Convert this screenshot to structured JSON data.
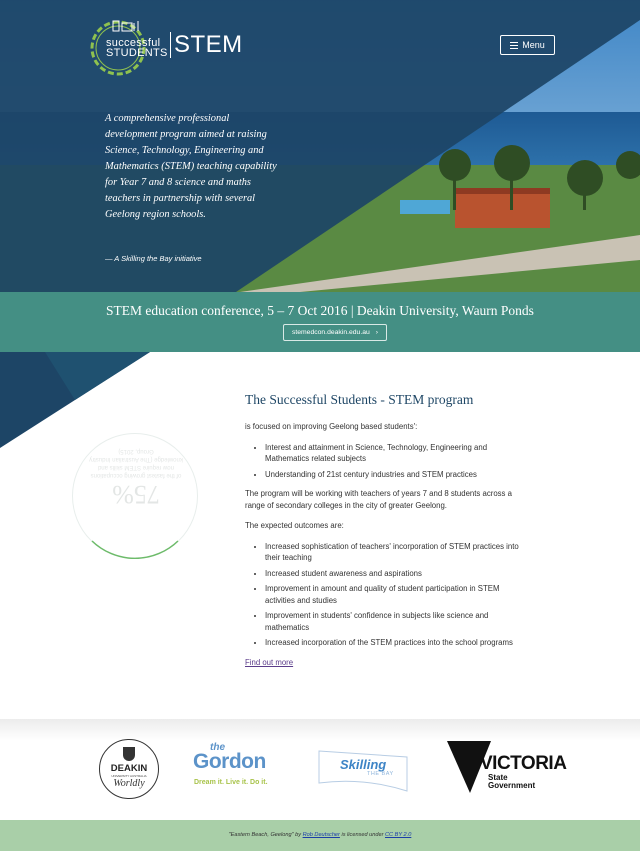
{
  "header": {
    "logo_small_line1": "successful",
    "logo_small_line2": "STUDENTS",
    "logo_stem": "STEM",
    "menu_label": "Menu"
  },
  "hero": {
    "intro": "A comprehensive professional development program aimed at raising Science, Technology, Engineering and Mathematics (STEM) teaching capability for Year 7 and 8 science and maths teachers in partnership with several Geelong region schools.",
    "credit": "— A Skilling the Bay initiative"
  },
  "conference": {
    "title": "STEM education conference, 5 – 7 Oct 2016 | Deakin University, Waurn Ponds",
    "link_label": "stemedcon.deakin.edu.au"
  },
  "stat": {
    "percent": "75%",
    "description": "of the fastest growing occupations now require STEM skills and knowledge (The Australian Industry Group, 2015)"
  },
  "program": {
    "heading": "The Successful Students - STEM program",
    "intro": "is focused on improving Geelong based students':",
    "focus_items": [
      "Interest and attainment in Science, Technology, Engineering and Mathematics related subjects",
      "Understanding of 21st century industries and STEM practices"
    ],
    "paragraph": "The program will be working with teachers of years 7 and 8 students across a range of secondary colleges in the city of greater Geelong.",
    "outcomes_label": "The expected outcomes are:",
    "outcomes": [
      "Increased sophistication of teachers' incorporation of STEM practices into their teaching",
      "Increased student awareness and aspirations",
      "Improvement in amount and quality of student participation in STEM activities and studies",
      "Improvement in students' confidence in subjects like science and mathematics",
      "Increased incorporation of the STEM practices into the school programs"
    ],
    "link_label": "Find out more"
  },
  "partners": {
    "deakin_name": "DEAKIN",
    "deakin_sub": "UNIVERSITY AUSTRALIA",
    "deakin_tag": "Worldly",
    "gordon_the": "the",
    "gordon_name": "Gordon",
    "gordon_tag": "Dream it. Live it. Do it.",
    "skilling_name": "Skilling",
    "skilling_sub": "THE BAY",
    "vic_name": "VICTORIA",
    "vic_sub1": "State",
    "vic_sub2": "Government"
  },
  "footer": {
    "photo_title": "\"Eastern Beach, Geelong\" by ",
    "author": "Rob Deutscher",
    "license_text": " is licensed under ",
    "license": "CC BY 2.0"
  },
  "colors": {
    "navy": "#1d4566",
    "teal": "#448f84",
    "footer_green": "#a9cfa8",
    "heading": "#1e4665"
  }
}
